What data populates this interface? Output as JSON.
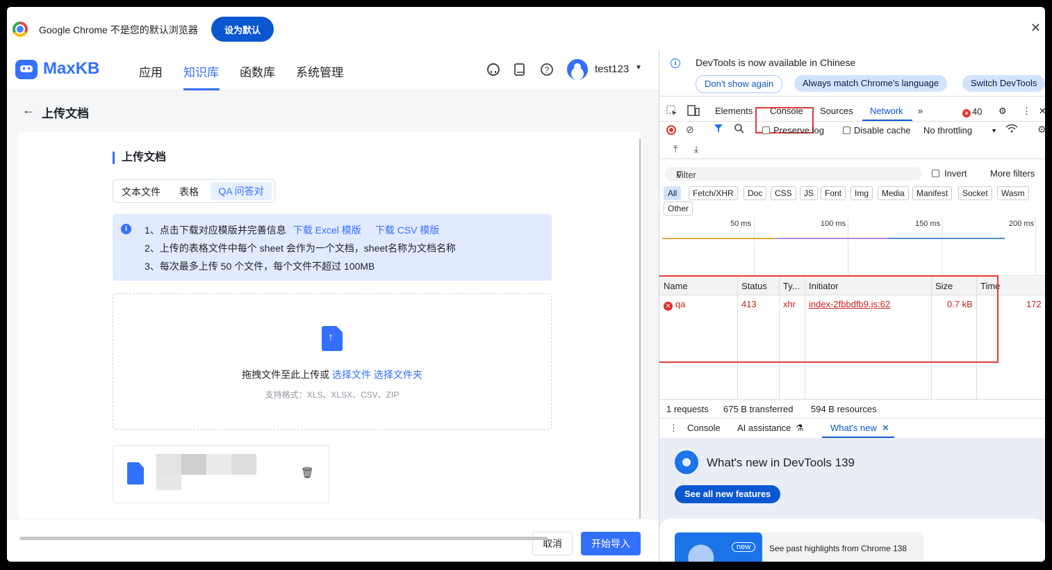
{
  "banner": {
    "text": "Google Chrome 不是您的默认浏览器",
    "set_default": "设为默认",
    "close": "✕"
  },
  "app": {
    "logo": "MaxKB",
    "nav": [
      "应用",
      "知识库",
      "函数库",
      "系统管理"
    ],
    "active_nav": "知识库",
    "username": "test123",
    "page_title": "上传文档",
    "card_title": "上传文档",
    "tabs": [
      "文本文件",
      "表格",
      "QA 问答对"
    ],
    "active_tab": "QA 问答对",
    "info": {
      "line1": "1、点击下载对应模版并完善信息",
      "link_excel": "下载 Excel 模版",
      "link_csv": "下载 CSV 模版",
      "line2": "2、上传的表格文件中每个 sheet 会作为一个文档，sheet名称为文档名称",
      "line3": "3、每次最多上传 50 个文件，每个文件不超过 100MB"
    },
    "drop": {
      "text": "拖拽文件至此上传或",
      "select_file": "选择文件",
      "select_folder": "选择文件夹",
      "formats": "支持格式：XLS、XLSX、CSV、ZIP"
    },
    "buttons": {
      "cancel": "取消",
      "import": "开始导入"
    }
  },
  "devtools": {
    "info_text": "DevTools is now available in Chinese",
    "info_buttons": [
      "Don't show again",
      "Always match Chrome's language",
      "Switch DevTools"
    ],
    "tabs": [
      "Elements",
      "Console",
      "Sources",
      "Network"
    ],
    "active_tab": "Network",
    "error_count": "40",
    "toolbar": {
      "preserve_log": "Preserve log",
      "disable_cache": "Disable cache",
      "throttling": "No throttling"
    },
    "filter": {
      "placeholder": "Filter",
      "invert": "Invert",
      "more_filters": "More filters"
    },
    "types": [
      "All",
      "Fetch/XHR",
      "Doc",
      "CSS",
      "JS",
      "Font",
      "Img",
      "Media",
      "Manifest",
      "Socket",
      "Wasm",
      "Other"
    ],
    "active_type": "All",
    "timeline_labels": [
      "50 ms",
      "100 ms",
      "150 ms",
      "200 ms"
    ],
    "table": {
      "columns": [
        "Name",
        "Status",
        "Ty...",
        "Initiator",
        "Size",
        "Time"
      ],
      "rows": [
        {
          "name": "qa",
          "status": "413",
          "type": "xhr",
          "initiator": "index-2fbbdfb9.js:62",
          "size": "0.7 kB",
          "time": "172"
        }
      ]
    },
    "summary": [
      "1 requests",
      "675 B transferred",
      "594 B resources"
    ],
    "drawer_tabs": [
      "Console",
      "AI assistance",
      "What's new"
    ],
    "active_drawer_tab": "What's new",
    "whats_new": {
      "title": "What's new in DevTools 139",
      "button": "See all new features",
      "badge": "new",
      "past": "See past highlights from Chrome 138"
    }
  }
}
